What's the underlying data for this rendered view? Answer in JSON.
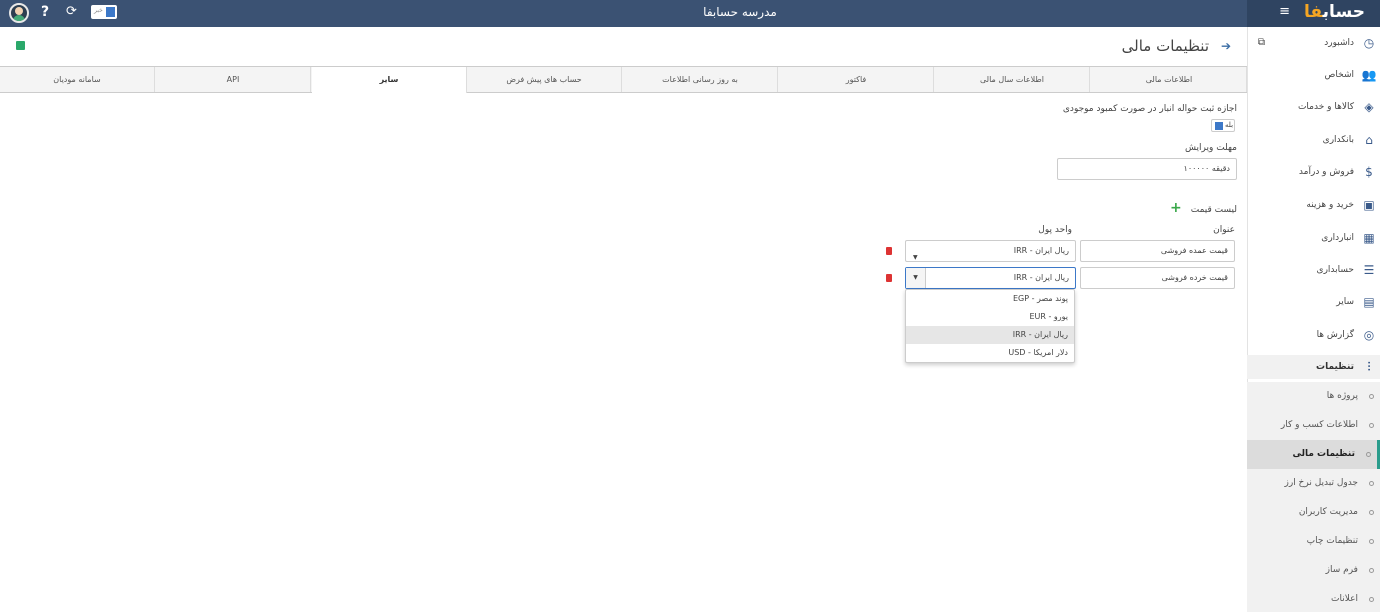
{
  "topbar": {
    "app_title": "مدرسه حسابفا",
    "logo_main": "حساب",
    "logo_accent": "فا",
    "flag_text": "خبر"
  },
  "sidebar": {
    "items": [
      {
        "label": "داشبورد",
        "icon": "dashboard-icon"
      },
      {
        "label": "اشخاص",
        "icon": "people-icon"
      },
      {
        "label": "کالاها و خدمات",
        "icon": "box-icon"
      },
      {
        "label": "بانکداری",
        "icon": "bank-icon"
      },
      {
        "label": "فروش و درآمد",
        "icon": "sales-icon"
      },
      {
        "label": "خرید و هزینه",
        "icon": "wallet-icon"
      },
      {
        "label": "انبارداری",
        "icon": "warehouse-icon"
      },
      {
        "label": "حسابداری",
        "icon": "ledger-icon"
      },
      {
        "label": "سایر",
        "icon": "other-icon"
      },
      {
        "label": "گزارش ها",
        "icon": "report-icon"
      },
      {
        "label": "تنظیمات",
        "icon": "settings-icon"
      }
    ],
    "sub_items": [
      {
        "label": "پروژه ها"
      },
      {
        "label": "اطلاعات کسب و کار"
      },
      {
        "label": "تنظیمات مالی"
      },
      {
        "label": "جدول تبدیل نرخ ارز"
      },
      {
        "label": "مدیریت کاربران"
      },
      {
        "label": "تنظیمات چاپ"
      },
      {
        "label": "فرم ساز"
      },
      {
        "label": "اعلانات"
      }
    ]
  },
  "page": {
    "title": "تنظیمات مالی"
  },
  "tabs": [
    "اطلاعات مالی",
    "اطلاعات سال مالی",
    "فاکتور",
    "به روز رسانی اطلاعات",
    "حساب های پیش فرض",
    "سایر",
    "API",
    "سامانه مودیان"
  ],
  "form": {
    "allow_label": "اجازه ثبت حواله انبار در صورت کمبود موجودی",
    "allow_value": "بله",
    "edit_deadline_label": "مهلت ویرایش",
    "edit_deadline_value": "۱۰۰۰۰۰ دقیقه",
    "price_list_label": "لیست قیمت",
    "col_title": "عنوان",
    "col_currency": "واحد پول",
    "rows": [
      {
        "title": "قیمت عمده فروشی",
        "currency": "IRR - ریال ایران"
      },
      {
        "title": "قیمت خرده فروشی",
        "currency": "IRR - ریال ایران"
      }
    ]
  },
  "dropdown": {
    "options": [
      "EGP - پوند مصر",
      "EUR - یورو",
      "IRR - ریال ایران",
      "USD - دلار امریکا"
    ],
    "selected": "IRR - ریال ایران"
  }
}
